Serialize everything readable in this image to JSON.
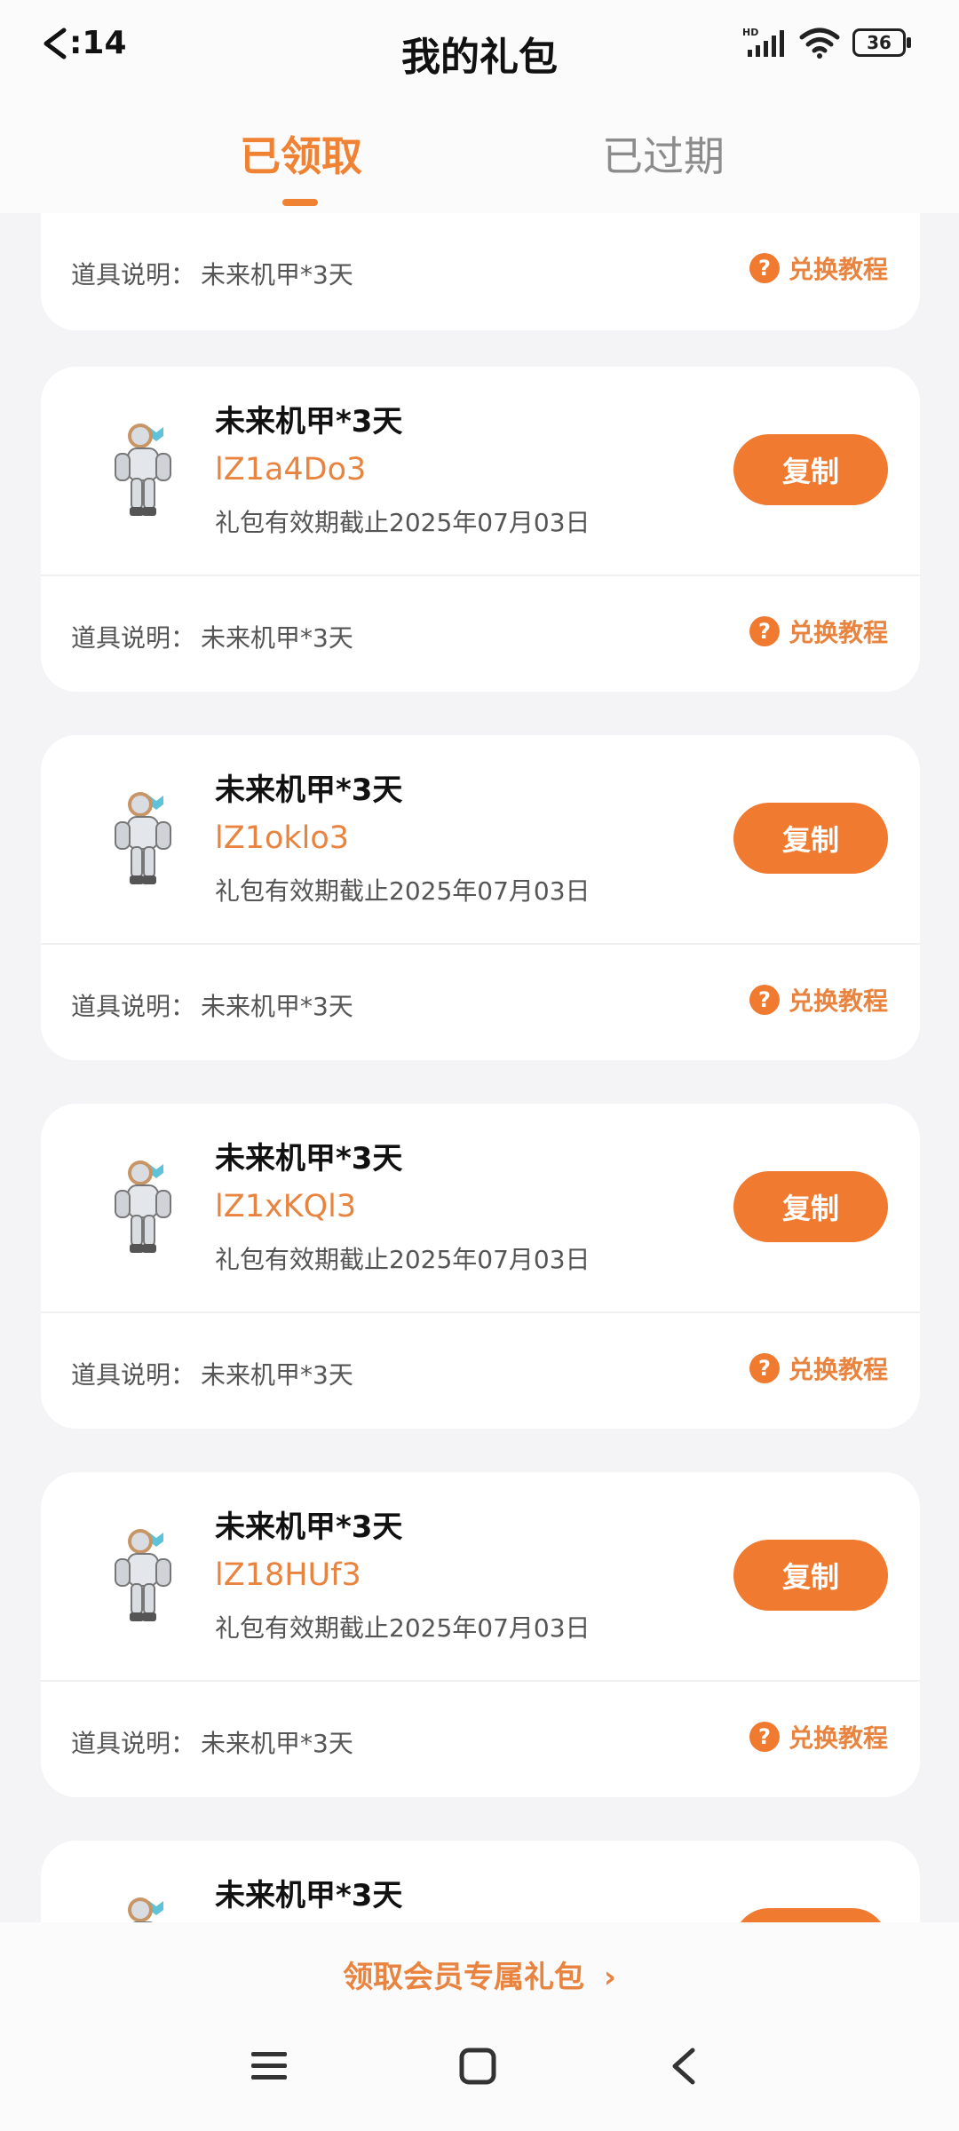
{
  "status": {
    "time": ":14",
    "battery": "36",
    "network": "HD"
  },
  "page_title": "我的礼包",
  "tabs": [
    {
      "label": "已领取",
      "active": true
    },
    {
      "label": "已过期",
      "active": false
    }
  ],
  "desc_label": "道具说明：",
  "tutorial_label": "兑换教程",
  "copy_label": "复制",
  "cards": [
    {
      "name": "",
      "code": "",
      "expiry": "",
      "desc": "未来机甲*3天",
      "partial": "top-cut"
    },
    {
      "name": "未来机甲*3天",
      "code": "lZ1a4Do3",
      "expiry": "礼包有效期截止2025年07月03日",
      "desc": "未来机甲*3天"
    },
    {
      "name": "未来机甲*3天",
      "code": "lZ1oklo3",
      "expiry": "礼包有效期截止2025年07月03日",
      "desc": "未来机甲*3天"
    },
    {
      "name": "未来机甲*3天",
      "code": "lZ1xKQl3",
      "expiry": "礼包有效期截止2025年07月03日",
      "desc": "未来机甲*3天"
    },
    {
      "name": "未来机甲*3天",
      "code": "lZ18HUf3",
      "expiry": "礼包有效期截止2025年07月03日",
      "desc": "未来机甲*3天"
    },
    {
      "name": "未来机甲*3天",
      "code": "",
      "expiry": "",
      "desc": "",
      "partial": "bottom-cut"
    }
  ],
  "footer": {
    "vip_link": "领取会员专属礼包",
    "vip_arrow": "›"
  },
  "nav_icons": [
    "menu-icon",
    "home-icon",
    "back-icon"
  ],
  "colors": {
    "accent": "#ef8233",
    "page_bg": "#f4f4f6",
    "card_bg": "#ffffff"
  }
}
